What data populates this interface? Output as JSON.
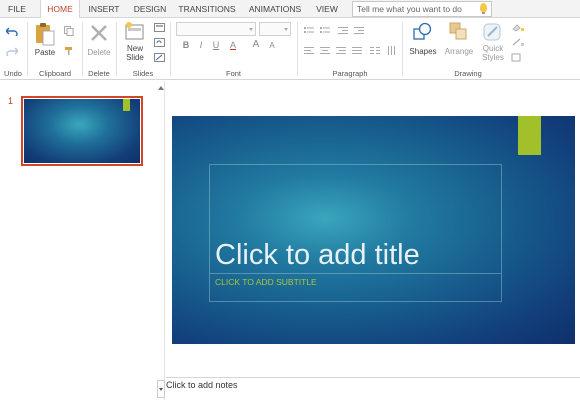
{
  "tabs": [
    {
      "label": "FILE",
      "active": false
    },
    {
      "label": "HOME",
      "active": true
    },
    {
      "label": "INSERT",
      "active": false
    },
    {
      "label": "DESIGN",
      "active": false
    },
    {
      "label": "TRANSITIONS",
      "active": false
    },
    {
      "label": "ANIMATIONS",
      "active": false
    },
    {
      "label": "VIEW",
      "active": false
    }
  ],
  "search": {
    "placeholder": "Tell me what you want to do"
  },
  "ribbon": {
    "groups": {
      "undo": "Undo",
      "clipboard": "Clipboard",
      "delete": "Delete",
      "slides": "Slides",
      "font": "Font",
      "paragraph": "Paragraph",
      "drawing": "Drawing"
    },
    "buttons": {
      "paste": "Paste",
      "delete": "Delete",
      "new_slide_line1": "New",
      "new_slide_line2": "Slide",
      "shapes": "Shapes",
      "arrange": "Arrange",
      "quick_styles_line1": "Quick",
      "quick_styles_line2": "Styles"
    },
    "font_buttons": {
      "bold": "B",
      "italic": "I",
      "underline": "U",
      "font_color": "A",
      "grow": "A",
      "shrink": "A"
    }
  },
  "thumbnails": [
    {
      "number": "1",
      "selected": true
    }
  ],
  "slide": {
    "title_placeholder": "Click to add title",
    "subtitle_placeholder": "CLICK TO ADD SUBTITLE"
  },
  "notes": {
    "placeholder": "Click to add notes"
  },
  "colors": {
    "accent": "#b7472a",
    "slide_accent": "#a1c02a",
    "slide_bg_light": "#3aa5bd",
    "slide_bg_dark": "#0f2f6a"
  }
}
